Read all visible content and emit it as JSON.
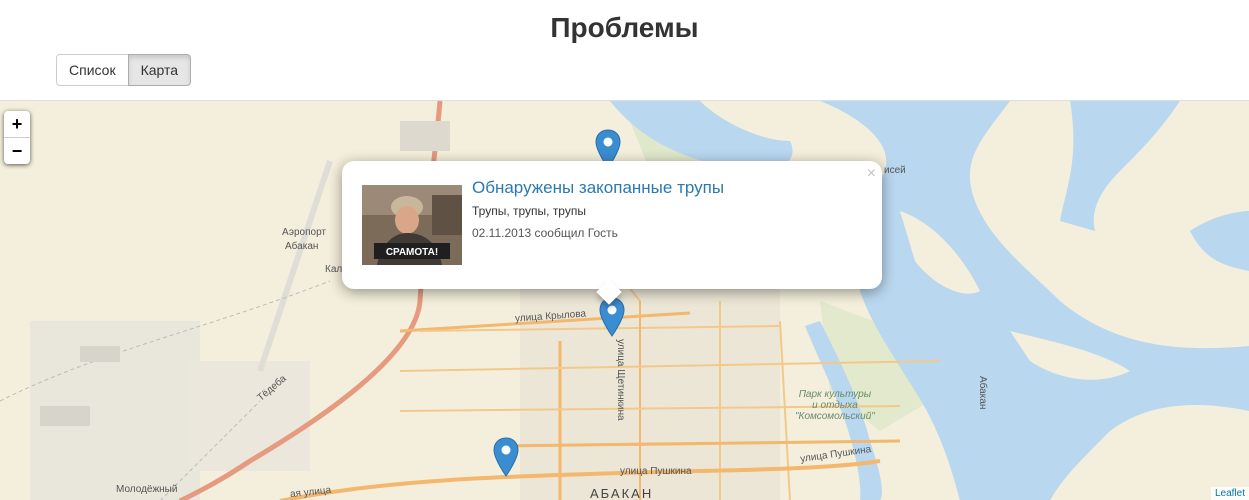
{
  "page": {
    "title": "Проблемы"
  },
  "view_toggle": {
    "list_label": "Список",
    "map_label": "Карта",
    "active": "map"
  },
  "map": {
    "zoom_in_label": "+",
    "zoom_out_label": "−",
    "attribution": "Leaflet",
    "labels": {
      "airport_line1": "Аэропорт",
      "airport_line2": "Абакан",
      "kal": "Кал",
      "krylova": "улица Крылова",
      "shchetinkina": "улица Щетинкина",
      "pushkina": "улица Пушкина",
      "pushkina2": "улица Пушкина",
      "park_line1": "Парк культуры",
      "park_line2": "и отдыха",
      "park_line3": "\"Комсомольский\"",
      "city": "АБАКАН",
      "molodezhny": "Молодёжный",
      "yenisey": "исей",
      "abakan_river": "Абакан",
      "tyoya": "Тёдеба",
      "street_bottom": "ая улица"
    },
    "colors": {
      "land": "#f4efdc",
      "water": "#b9d8f0",
      "road_major": "#f3b76e",
      "road_red": "#e69a80",
      "marker": "#3b8dd1"
    }
  },
  "popup": {
    "title": "Обнаружены закопанные трупы",
    "description": "Трупы, трупы, трупы",
    "meta": "02.11.2013 сообщил Гость",
    "close_label": "×",
    "image_caption": "СРАМОТА!"
  }
}
